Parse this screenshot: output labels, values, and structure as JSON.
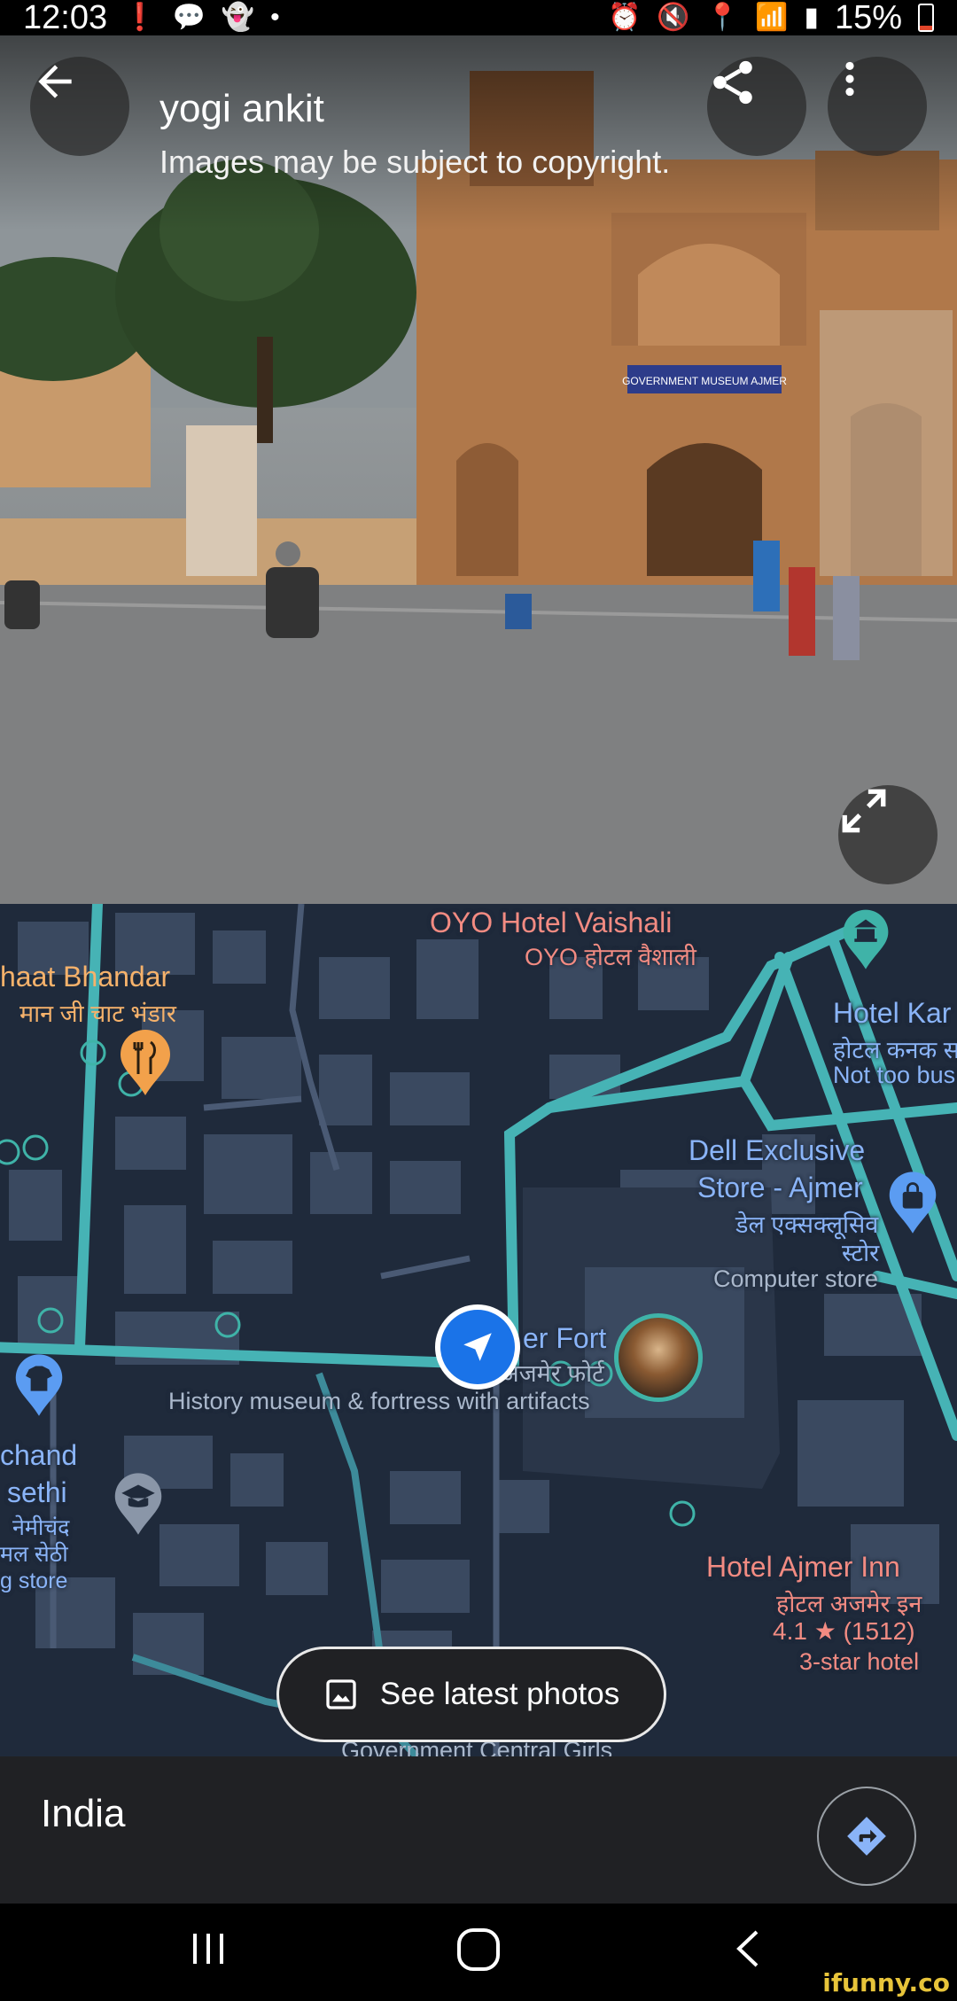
{
  "status_bar": {
    "time": "12:03",
    "battery": "15%",
    "icons": [
      "alert-icon",
      "chat-icon",
      "ghost-icon",
      "dot-icon",
      "alarm-icon",
      "mute-icon",
      "location-icon",
      "wifi-icon",
      "signal-icon",
      "battery-icon"
    ]
  },
  "header": {
    "title": "yogi ankit",
    "subtitle": "Images may be subject to copyright."
  },
  "photo": {
    "signboard": "GOVERNMENT MUSEUM AJMER"
  },
  "map": {
    "labels": {
      "oyo_name": "OYO Hotel Vaishali",
      "oyo_hindi": "OYO होटल वैशाली",
      "bhandar_name": "haat Bhandar",
      "bhandar_hindi": "मान जी चाट भंडार",
      "hotel_kanak_name": "Hotel Kar",
      "hotel_kanak_hindi": "होटल कनक स",
      "hotel_kanak_status": "Not too bus",
      "dell_line1": "Dell Exclusive",
      "dell_line2": "Store - Ajmer",
      "dell_hindi1": "डेल एक्सक्लूसिव",
      "dell_hindi2": "स्टोर",
      "dell_category": "Computer store",
      "fort_name": "er Fort",
      "fort_hindi": "अजमेर फोर्ट",
      "fort_desc": "History museum & fortress with artifacts",
      "chand_line1": "chand",
      "chand_line2": "sethi",
      "chand_hindi1": "नेमीचंद",
      "chand_hindi2": "मल सेठी",
      "chand_category": "g store",
      "inn_name": "Hotel Ajmer Inn",
      "inn_hindi": "होटल अजमेर इन",
      "inn_rating": "4.1",
      "inn_reviews": "(1512)",
      "inn_category": "3-star hotel",
      "circle_partial": "Government Central Girls"
    },
    "see_photos_label": "See latest photos"
  },
  "bottom_sheet": {
    "location": "India"
  },
  "watermark": "ifunny.co",
  "colors": {
    "map_bg": "#1f2a3b",
    "road": "#46b3b5",
    "poi_text": "#f28b82",
    "accent_blue": "#1a73e8"
  }
}
